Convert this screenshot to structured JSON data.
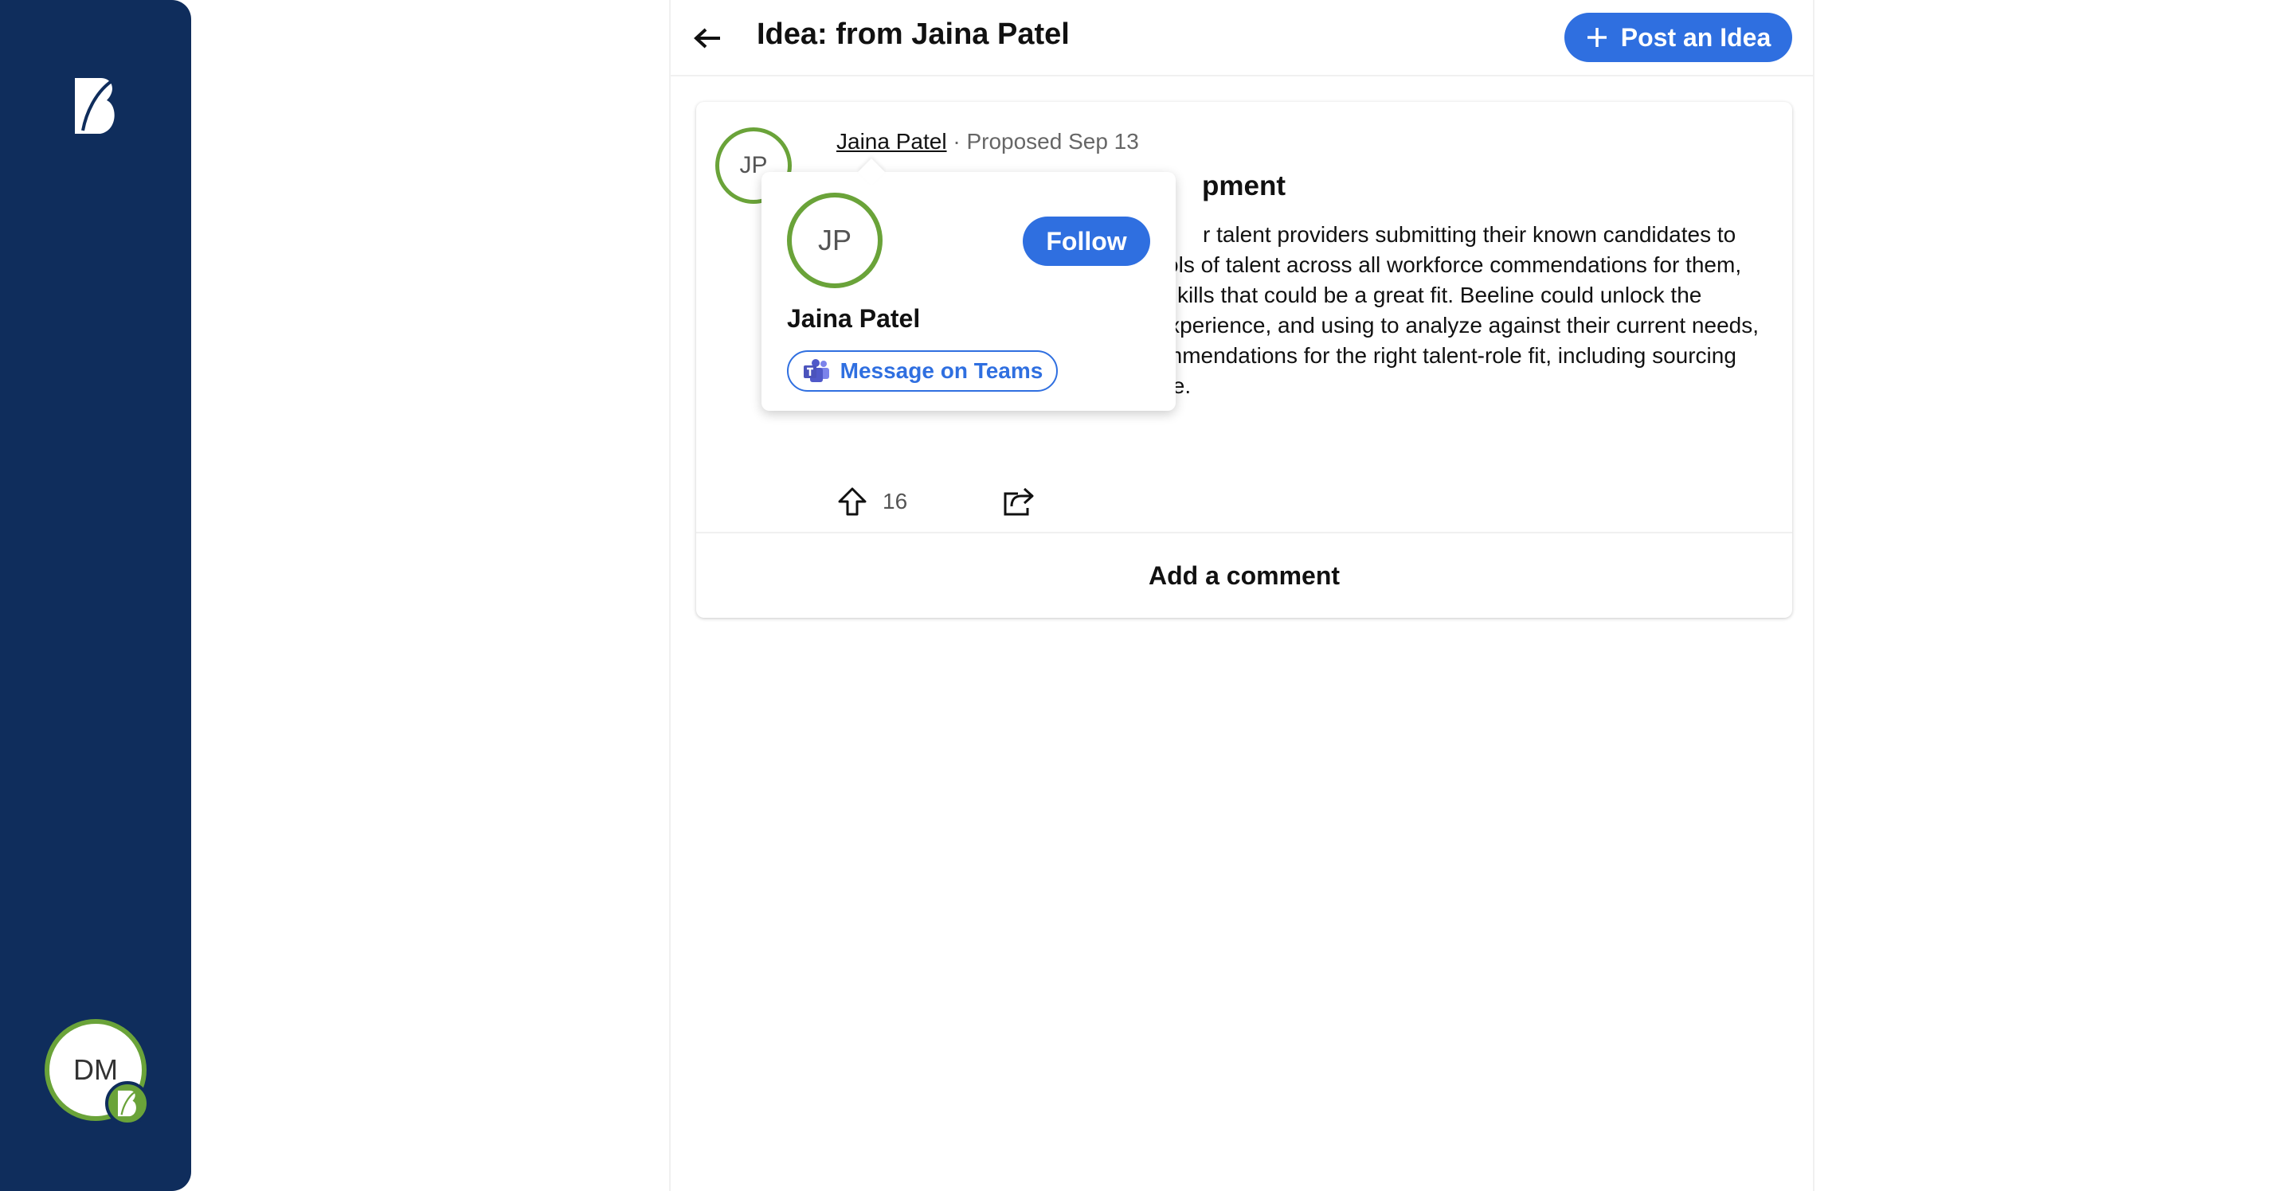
{
  "sidebar": {
    "logo_icon": "beeline-logo-icon",
    "user_initials": "DM",
    "user_badge_icon": "beeline-badge-icon",
    "background": "#0f2d5c"
  },
  "header": {
    "title": "Idea: from Jaina Patel",
    "post_button_label": "Post an Idea",
    "back_icon": "arrow-left-icon",
    "post_icon": "plus-icon"
  },
  "idea": {
    "author_initials": "JP",
    "author_name": "Jaina Patel",
    "separator": "·",
    "proposed_text": "Proposed Sep 13",
    "title_visible": "pment",
    "body": "r talent providers submitting their known candidates to open s to look within their own pools of talent across all workforce commendations for them, even with those workers who may kills that could be a great fit. Beeline could unlock the sessing their skills and previous experience, and using to analyze against their current needs, therein proactively providing recommendations for the right talent-role fit, including sourcing methods, rates, locations and more.",
    "upvote_count": "16",
    "upvote_icon": "arrow-up-icon",
    "share_icon": "share-icon",
    "add_comment_label": "Add a comment"
  },
  "popover": {
    "initials": "JP",
    "name": "Jaina Patel",
    "follow_label": "Follow",
    "teams_label": "Message on Teams",
    "teams_icon": "teams-icon"
  },
  "colors": {
    "accent": "#2f6fe0",
    "avatar_ring": "#6aa339"
  }
}
